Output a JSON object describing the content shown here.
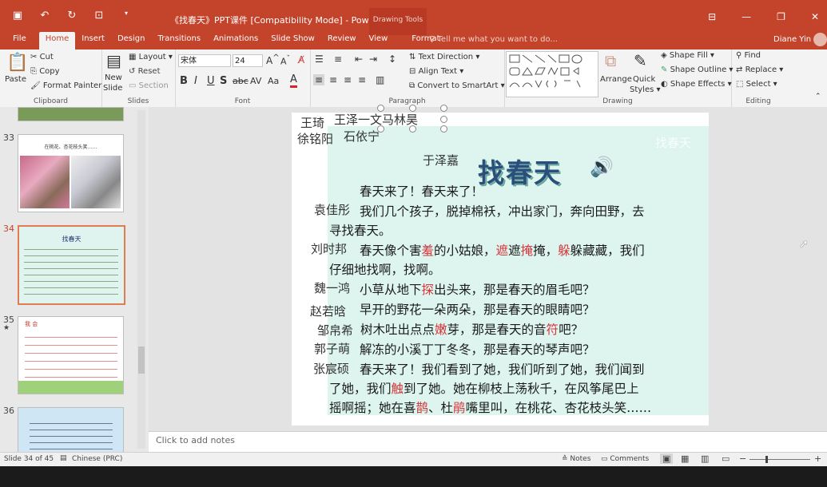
{
  "window": {
    "title": "《找春天》PPT课件 [Compatibility Mode] - PowerPoint",
    "context_tab": "Drawing Tools",
    "user": "Diane Yin"
  },
  "tabs": [
    "File",
    "Home",
    "Insert",
    "Design",
    "Transitions",
    "Animations",
    "Slide Show",
    "Review",
    "View",
    "Format"
  ],
  "tell_me": "Tell me what you want to do...",
  "ribbon": {
    "clipboard": {
      "label": "Clipboard",
      "paste": "Paste",
      "cut": "Cut",
      "copy": "Copy",
      "format_painter": "Format Painter"
    },
    "slides": {
      "label": "Slides",
      "new_slide": "New",
      "new_slide2": "Slide",
      "layout": "Layout",
      "reset": "Reset",
      "section": "Section"
    },
    "font": {
      "label": "Font",
      "font_name": "宋体",
      "font_size": "24"
    },
    "paragraph": {
      "label": "Paragraph",
      "text_direction": "Text Direction",
      "align_text": "Align Text",
      "smartart": "Convert to SmartArt"
    },
    "drawing": {
      "label": "Drawing",
      "arrange": "Arrange",
      "quick_styles": "Quick",
      "quick_styles2": "Styles",
      "shape_fill": "Shape Fill",
      "shape_outline": "Shape Outline",
      "shape_effects": "Shape Effects"
    },
    "editing": {
      "label": "Editing",
      "find": "Find",
      "replace": "Replace",
      "select": "Select"
    }
  },
  "thumbnails": [
    {
      "num": "33",
      "title": "在桃花、杏花枝头笑……"
    },
    {
      "num": "34",
      "title": "找春天"
    },
    {
      "num": "35",
      "label": "我 会"
    },
    {
      "num": "36"
    }
  ],
  "slide": {
    "names_top": {
      "a": "王琦",
      "b": "王泽一文马林昊",
      "c": "徐铭阳",
      "d": "石依宁",
      "e": "于泽嘉"
    },
    "title": "找春天",
    "faint_title": "找春天",
    "lines": [
      {
        "name": "",
        "parts": [
          "春天来了！春天来了！"
        ]
      },
      {
        "name": "袁佳彤",
        "parts": [
          "我们几个孩子，脱掉棉袄，冲出家门，奔向田野，去"
        ]
      },
      {
        "name": "",
        "parts": [
          "寻找春天。"
        ]
      },
      {
        "name": "刘时邦",
        "parts": [
          "春天像个害",
          "羞",
          "的小姑娘，",
          "遮",
          "遮",
          "掩",
          "掩，",
          "躲",
          "躲藏藏，我们"
        ]
      },
      {
        "name": "",
        "parts": [
          "仔细地找啊，找啊。"
        ]
      },
      {
        "name": "魏一鸿",
        "parts": [
          "小草从地下",
          "探",
          "出头来，那是春天的眉毛吧？"
        ]
      },
      {
        "name": "赵若晗",
        "parts": [
          "早开的野花一朵两朵，那是春天的眼睛吧？"
        ]
      },
      {
        "name": "邹帛希",
        "parts": [
          "树木吐出点点",
          "嫩",
          "芽，那是春天的音",
          "符",
          "吧？"
        ]
      },
      {
        "name": "郭子萌",
        "parts": [
          "解冻的小溪丁丁冬冬，那是春天的琴声吧？"
        ]
      },
      {
        "name": "张宸硕",
        "parts": [
          "春天来了！我们看到了她，我们听到了她，我们闻到"
        ]
      },
      {
        "name": "",
        "parts": [
          "了她，我们",
          "触",
          "到了她。她在柳枝上荡秋千，在风筝尾巴上"
        ]
      },
      {
        "name": "",
        "parts": [
          "摇啊摇；她在喜",
          "鹊",
          "、杜",
          "鹃",
          "嘴里叫，在桃花、杏花枝头笑……"
        ]
      }
    ]
  },
  "notes_placeholder": "Click to add notes",
  "status": {
    "slide_info": "Slide 34 of 45",
    "language": "Chinese (PRC)",
    "notes": "Notes",
    "comments": "Comments"
  },
  "colors": {
    "accent": "#c4432b",
    "slide_bg": "#ddf5ee",
    "highlight": "#d8343b"
  }
}
